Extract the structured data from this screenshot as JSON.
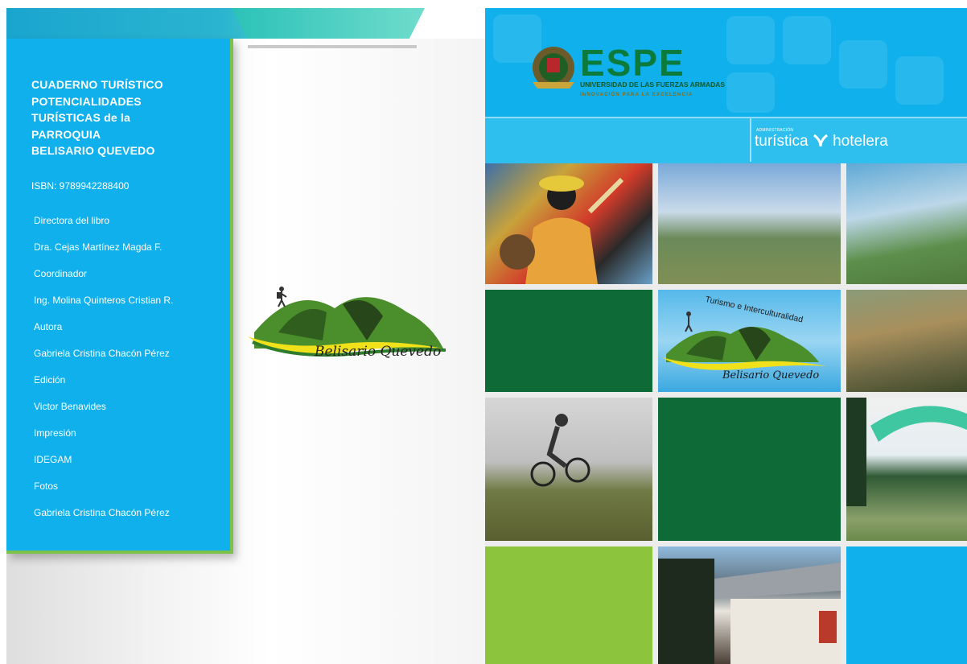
{
  "left_page": {
    "title": "CUADERNO TURÍSTICO\nPOTENCIALIDADES\nTURÍSTICAS de la\nPARROQUIA\nBELISARIO QUEVEDO",
    "isbn": "ISBN: 9789942288400",
    "credits": [
      "Directora del libro",
      "Dra. Cejas Martínez Magda F.",
      "Coordinador",
      "Ing. Molina Quinteros Cristian R.",
      "Autora",
      "Gabriela Cristina Chacón Pérez",
      "Edición",
      "Victor Benavides",
      "Impresión",
      "IDEGAM",
      "Fotos",
      "Gabriela Cristina Chacón Pérez"
    ],
    "logo_text": "Belisario Quevedo"
  },
  "right_page": {
    "espe": {
      "wordmark": "ESPE",
      "university": "UNIVERSIDAD DE LAS FUERZAS ARMADAS",
      "tagline": "INNOVACIÓN PARA LA EXCELENCIA"
    },
    "admin_label": "ADMINISTRACIÓN",
    "brand_left": "turística",
    "brand_right": "hotelera",
    "grid_logo": {
      "arc_text": "Turismo e Interculturalidad",
      "caption": "Belisario Quevedo"
    }
  },
  "colors": {
    "panel_blue": "#0fb0ec",
    "accent_lime": "#8cc43e",
    "dark_green": "#0e6b38"
  }
}
